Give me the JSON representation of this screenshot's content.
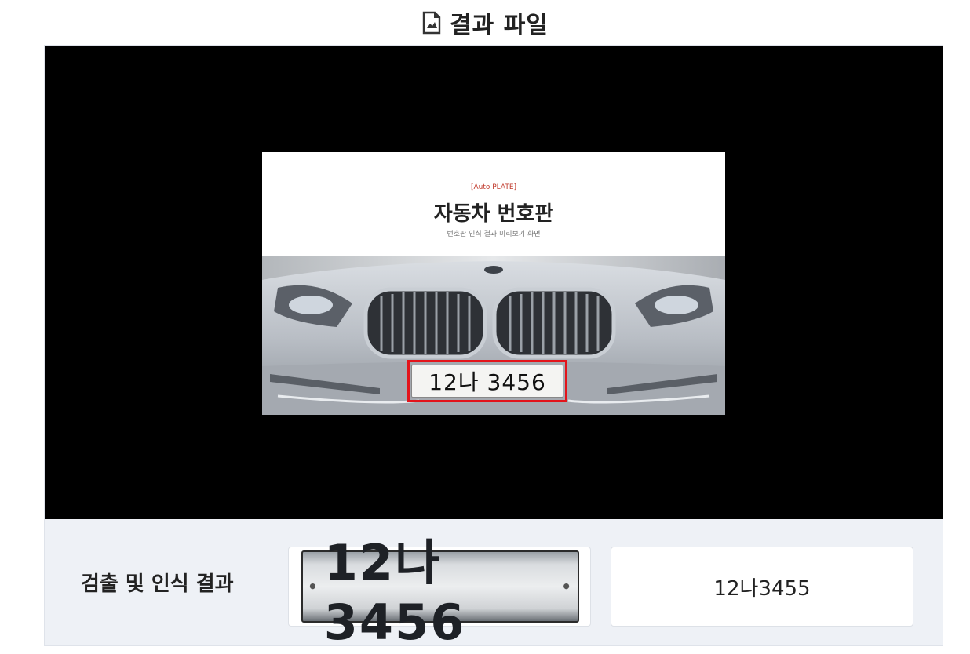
{
  "header": {
    "title": "결과 파일",
    "icon": "document-icon"
  },
  "preview": {
    "banner_tag": "[Auto PLATE]",
    "banner_heading": "자동차 번호판",
    "banner_sub": "번호판 인식 결과 미리보기 화면",
    "plate_text": "12나 3456"
  },
  "result": {
    "label": "검출 및 인식 결과",
    "crop_plate_text": "12나 3456",
    "recognized_text": "12나3455"
  },
  "colors": {
    "detect_box": "#e3141b",
    "viewer_bg": "#000000",
    "panel_bg": "#eef1f6"
  }
}
